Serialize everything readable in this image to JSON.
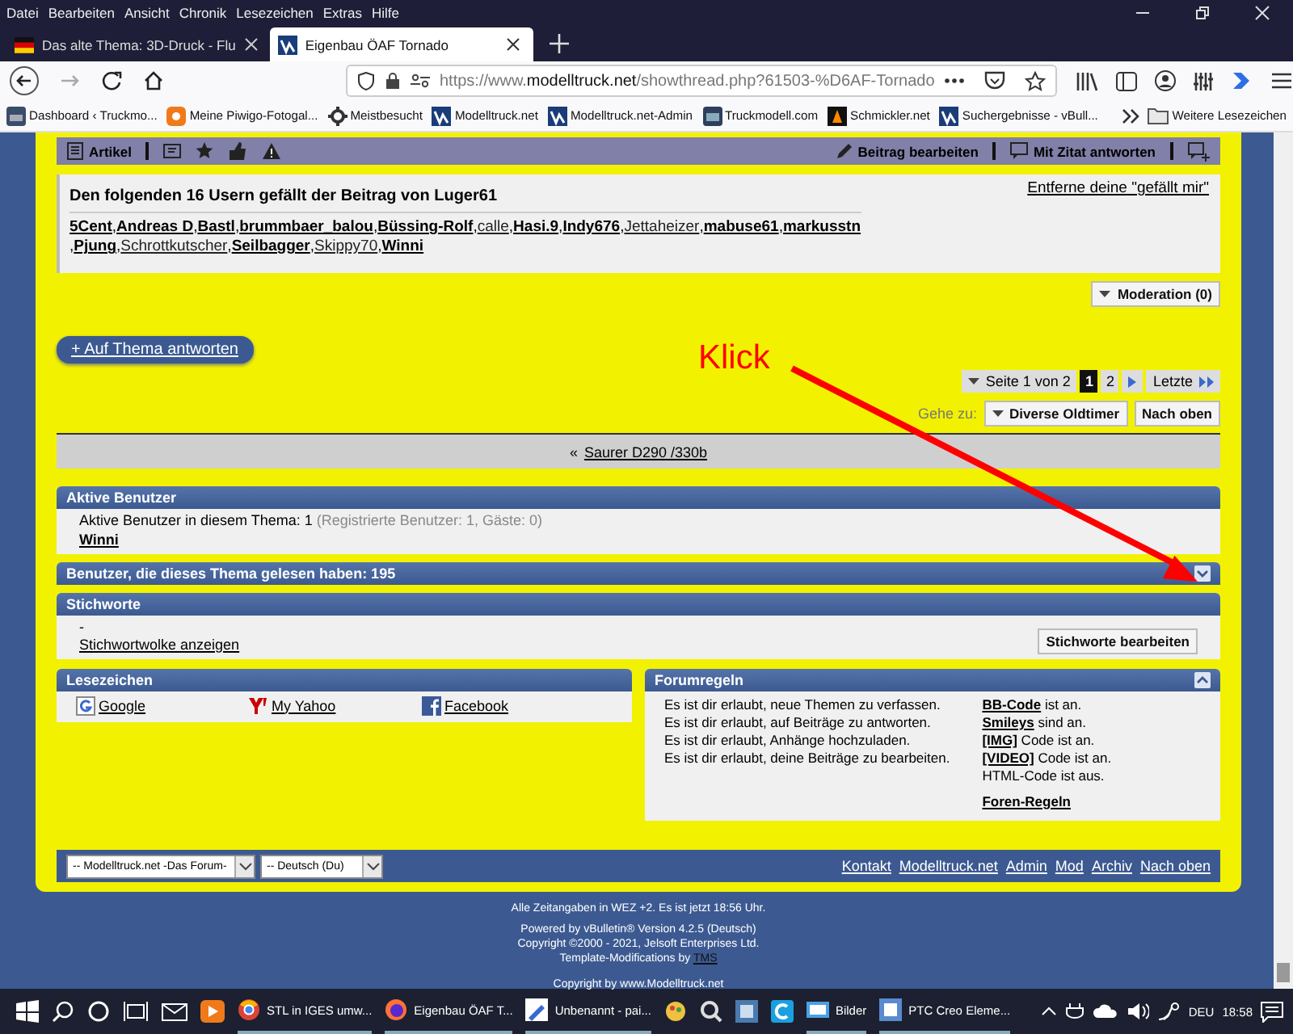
{
  "browser": {
    "menu": [
      "Datei",
      "Bearbeiten",
      "Ansicht",
      "Chronik",
      "Lesezeichen",
      "Extras",
      "Hilfe"
    ],
    "tabs": [
      {
        "title": "Das alte Thema: 3D-Druck - Flu",
        "selected": false
      },
      {
        "title": "Eigenbau ÖAF Tornado",
        "selected": true
      }
    ],
    "url": {
      "scheme": "https://www.",
      "host": "modelltruck.net",
      "path": "/showthread.php?61503-%D6AF-Tornado"
    },
    "bookmarks": [
      "Dashboard ‹ Truckmo...",
      "Meine Piwigo-Fotogal...",
      "Meistbesucht",
      "Modelltruck.net",
      "Modelltruck.net-Admin",
      "Truckmodell.com",
      "Schmickler.net",
      "Suchergebnisse - vBull..."
    ],
    "more_bookmarks": "Weitere Lesezeichen"
  },
  "post_toolbar": {
    "left": "Artikel",
    "right": [
      "Beitrag bearbeiten",
      "Mit Zitat antworten"
    ]
  },
  "likes": {
    "heading": "Den folgenden 16 Usern gefällt der Beitrag von Luger61",
    "remove_link": "Entferne deine \"gefällt mir\"",
    "separator": ",",
    "users": [
      {
        "name": "5Cent",
        "bold": true
      },
      {
        "name": "Andreas D",
        "bold": true
      },
      {
        "name": "Bastl",
        "bold": true
      },
      {
        "name": "brummbaer_balou",
        "bold": true
      },
      {
        "name": "Büssing-Rolf",
        "bold": true
      },
      {
        "name": "calle",
        "bold": false
      },
      {
        "name": "Hasi.9",
        "bold": true
      },
      {
        "name": "Indy676",
        "bold": true
      },
      {
        "name": "Jettaheizer",
        "bold": false
      },
      {
        "name": "mabuse61",
        "bold": true
      },
      {
        "name": "markusstn",
        "bold": true
      },
      {
        "name": "Pjung",
        "bold": true
      },
      {
        "name": "Schrottkutscher",
        "bold": false
      },
      {
        "name": "Seilbagger",
        "bold": true
      },
      {
        "name": "Skippy70",
        "bold": false
      },
      {
        "name": "Winni",
        "bold": true
      }
    ]
  },
  "moderation": "Moderation (0)",
  "reply_button": "+ Auf Thema antworten",
  "pagination": {
    "label": "Seite 1 von 2",
    "pages": [
      {
        "label": "1",
        "selected": true
      },
      {
        "label": "2",
        "selected": false
      }
    ],
    "last": "Letzte"
  },
  "goto": {
    "label": "Gehe zu:",
    "forum": "Diverse Oldtimer",
    "top": "Nach oben"
  },
  "next_thread": {
    "prefix": "«",
    "title": "Saurer D290 /330b"
  },
  "active_users": {
    "title": "Aktive Benutzer",
    "summary": "Aktive Benutzer in diesem Thema: 1",
    "detail": "(Registrierte Benutzer: 1, Gäste: 0)",
    "users": [
      "Winni"
    ]
  },
  "readers": {
    "title": "Benutzer, die dieses Thema gelesen haben: 195",
    "expanded": false
  },
  "tags": {
    "title": "Stichworte",
    "value": "-",
    "cloud_link": "Stichwortwolke anzeigen",
    "edit_button": "Stichworte bearbeiten"
  },
  "social_bookmarks": {
    "title": "Lesezeichen",
    "items": [
      "Google",
      "My Yahoo",
      "Facebook"
    ]
  },
  "forum_rules": {
    "title": "Forumregeln",
    "expanded": true,
    "permissions": [
      "Es ist dir erlaubt, neue Themen zu verfassen.",
      "Es ist dir erlaubt, auf Beiträge zu antworten.",
      "Es ist dir erlaubt, Anhänge hochzuladen.",
      "Es ist dir erlaubt, deine Beiträge zu bearbeiten."
    ],
    "codes": [
      "**BB-Code** ist an.",
      "**Smileys** sind an.",
      "**[IMG]** Code ist an.",
      "**[VIDEO]** Code ist an.",
      "HTML-Code ist aus."
    ],
    "rules_link": "Foren-Regeln"
  },
  "footer": {
    "selects": [
      "-- Modelltruck.net -Das Forum-",
      "-- Deutsch (Du)"
    ],
    "links": [
      "Kontakt",
      "Modelltruck.net",
      "Admin",
      "Mod",
      "Archiv",
      "Nach oben"
    ]
  },
  "credits": {
    "time": "Alle Zeitangaben in WEZ +2. Es ist jetzt 18:56 Uhr.",
    "lines": [
      "Powered by vBulletin® Version 4.2.5 (Deutsch)",
      "Copyright ©2000 - 2021, Jelsoft Enterprises Ltd."
    ],
    "template": "Template-Modifications by",
    "template_link": "TMS",
    "copyright": "Copyright by www.Modelltruck.net"
  },
  "annotation": {
    "text": "Klick"
  },
  "taskbar": {
    "apps": [
      "STL in IGES umw...",
      "Eigenbau ÖAF T...",
      "Unbenannt - pai...",
      "Bilder",
      "PTC Creo Eleme..."
    ],
    "language": "DEU",
    "time": "18:58"
  }
}
